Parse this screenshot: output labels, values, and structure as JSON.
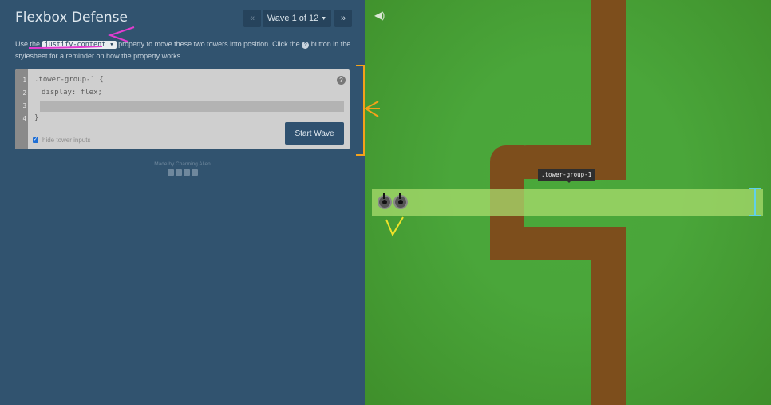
{
  "header": {
    "title": "Flexbox Defense",
    "prev_label": "«",
    "wave_label": "Wave 1 of 12",
    "next_label": "»"
  },
  "instructions": {
    "prefix": "Use the",
    "property": "justify-content",
    "middle": "property to move these two towers into position. Click the",
    "help_glyph": "?",
    "suffix": "button in the stylesheet for a reminder on how the property works."
  },
  "editor": {
    "line_numbers": [
      "1",
      "2",
      "3",
      "4"
    ],
    "line1": ".tower-group-1 {",
    "line2": "display: flex;",
    "line4": "}",
    "input_value": "",
    "help_glyph": "?",
    "start_wave_label": "Start Wave",
    "hide_inputs_label": "hide tower inputs",
    "hide_inputs_checked": true
  },
  "footer": {
    "credit": "Made by Channing Allen"
  },
  "game": {
    "tooltip": ".tower-group-1",
    "sound_icon": "speaker-icon",
    "tower_count": 2
  },
  "colors": {
    "panel": "#31536f",
    "button": "#2f5170",
    "grass": "#4aa83a",
    "path": "#7d4e1c",
    "lane": "#a9dc6e"
  }
}
